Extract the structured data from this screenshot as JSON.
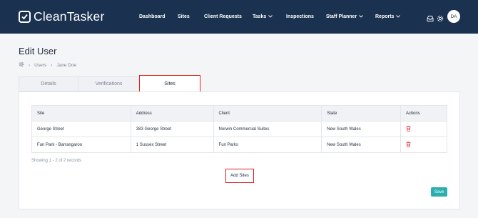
{
  "app": {
    "name": "CleanTasker"
  },
  "nav": {
    "items": [
      {
        "label": "Dashboard"
      },
      {
        "label": "Sites"
      },
      {
        "label": "Client Requests"
      },
      {
        "label": "Tasks"
      },
      {
        "label": "Inspections"
      },
      {
        "label": "Staff Planner"
      },
      {
        "label": "Reports"
      }
    ],
    "user_initials": "DA"
  },
  "page": {
    "title": "Edit User",
    "breadcrumb": [
      "Users",
      "Jane Doe"
    ]
  },
  "tabs": [
    {
      "label": "Details"
    },
    {
      "label": "Verifications"
    },
    {
      "label": "Sites"
    }
  ],
  "active_tab": "Sites",
  "table": {
    "headers": [
      "Site",
      "Address",
      "Client",
      "State",
      "Actions"
    ],
    "rows": [
      [
        "George Street",
        "383 George Street",
        "Norwin Commercial Suites",
        "New South Wales"
      ],
      [
        "Fun Park - Barrangaroo",
        "1 Sussex Street",
        "Fun Parks",
        "New South Wales"
      ]
    ]
  },
  "records_text": "Showing 1 - 2 of 2 records",
  "buttons": {
    "add_sites": "Add Sites",
    "save": "Save"
  },
  "colors": {
    "nav_bg": "#1a3150",
    "accent": "#2aaeb0",
    "highlight": "#e01e1e",
    "delete": "#e0474c"
  }
}
